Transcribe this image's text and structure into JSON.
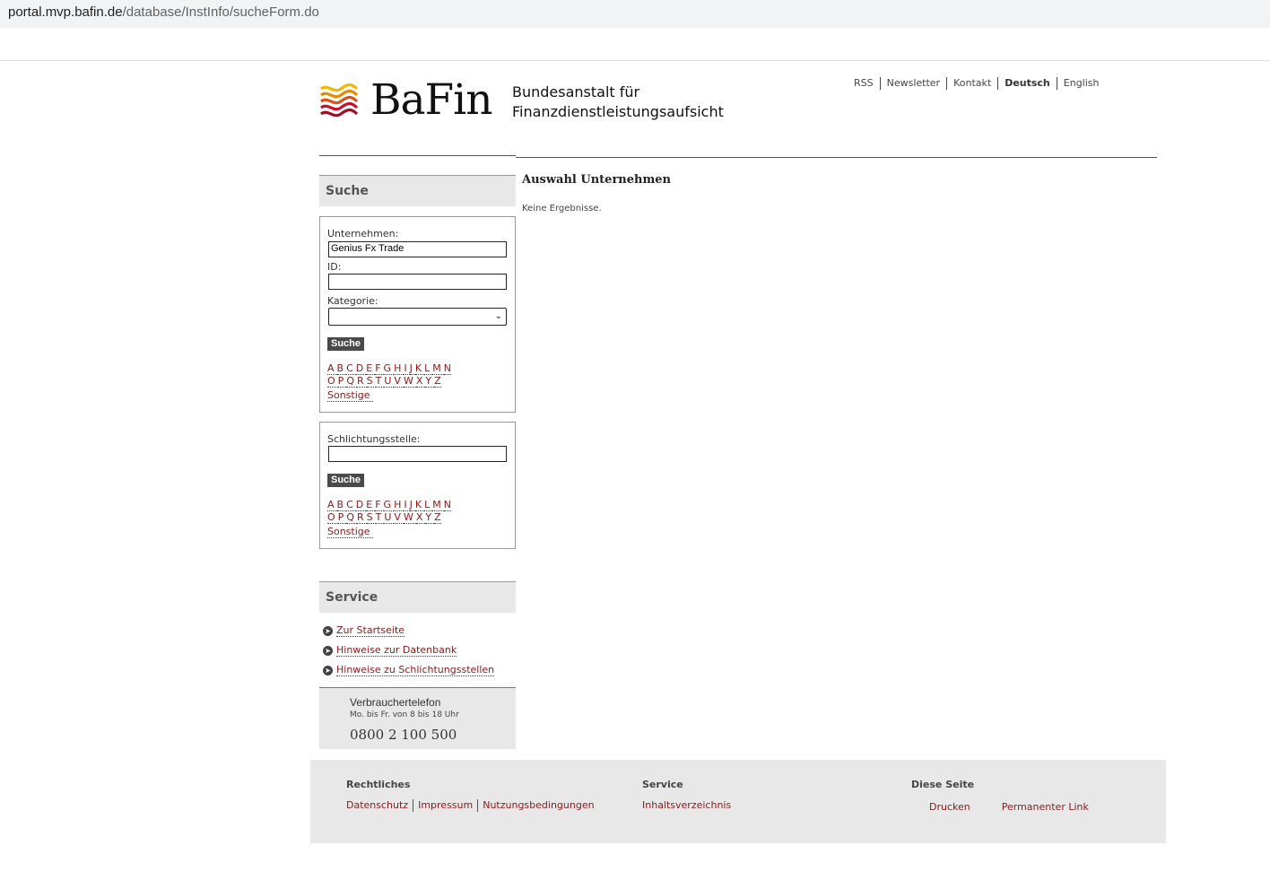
{
  "browser": {
    "url_host": "portal.mvp.bafin.de",
    "url_path": "/database/InstInfo/sucheForm.do"
  },
  "header": {
    "logo_word": "BaFin",
    "logo_sub_line1": "Bundesanstalt für",
    "logo_sub_line2": "Finanzdienstleistungsaufsicht",
    "meta_nav": [
      "RSS",
      "Newsletter",
      "Kontakt",
      "Deutsch",
      "English"
    ],
    "active_language": "Deutsch",
    "brand_colors": {
      "red": "#c8102e",
      "yellow": "#f2b700"
    }
  },
  "sidebar": {
    "search_heading": "Suche",
    "company_form": {
      "company_label": "Unternehmen:",
      "company_value": "Genius Fx Trade",
      "id_label": "ID:",
      "id_value": "",
      "category_label": "Kategorie:",
      "category_value": "",
      "submit_label": "Suche"
    },
    "arbitration_form": {
      "label": "Schlichtungsstelle:",
      "value": "",
      "submit_label": "Suche"
    },
    "alphabet_row1": [
      "A",
      "B",
      "C",
      "D",
      "E",
      "F",
      "G",
      "H",
      "I",
      "J",
      "K",
      "L",
      "M",
      "N"
    ],
    "alphabet_row2": [
      "O",
      "P",
      "Q",
      "R",
      "S",
      "T",
      "U",
      "V",
      "W",
      "X",
      "Y",
      "Z"
    ],
    "other_label": "Sonstige",
    "service_heading": "Service",
    "service_links": [
      "Zur Startseite",
      "Hinweise zur Datenbank",
      "Hinweise zu Schlichtungsstellen"
    ],
    "phone": {
      "title": "Verbrauchertelefon",
      "hours": "Mo. bis Fr. von 8 bis 18 Uhr",
      "number": "0800 2 100 500"
    }
  },
  "main": {
    "title": "Auswahl Unternehmen",
    "result_text": "Keine Ergebnisse."
  },
  "footer": {
    "legal_heading": "Rechtliches",
    "legal_links": [
      "Datenschutz",
      "Impressum",
      "Nutzungsbedingungen"
    ],
    "service_heading": "Service",
    "service_links": [
      "Inhaltsverzeichnis"
    ],
    "page_heading": "Diese Seite",
    "page_links": [
      "Drucken",
      "Permanenter Link"
    ]
  }
}
